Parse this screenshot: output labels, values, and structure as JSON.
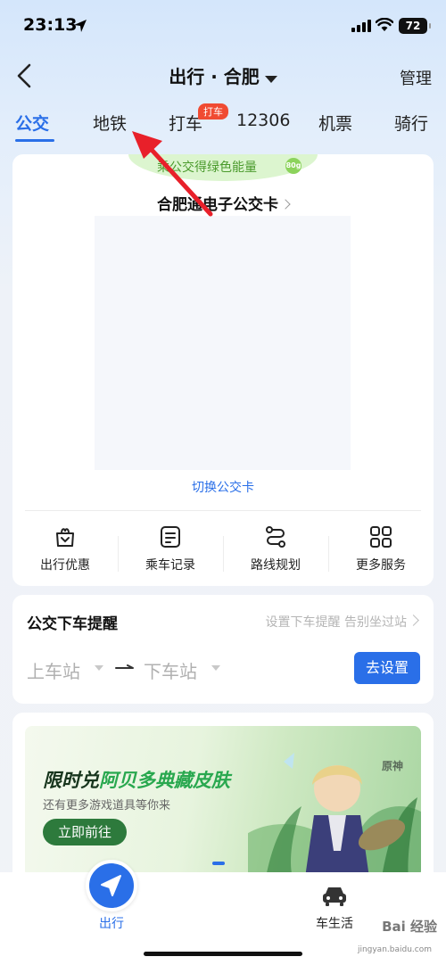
{
  "status_bar": {
    "time": "23:13",
    "battery": "72"
  },
  "nav": {
    "title": "出行 · 合肥",
    "manage": "管理"
  },
  "tabs": [
    {
      "label": "公交",
      "active": true
    },
    {
      "label": "地铁"
    },
    {
      "label": "打车",
      "badge": "打车"
    },
    {
      "label": "12306"
    },
    {
      "label": "机票"
    },
    {
      "label": "骑行"
    }
  ],
  "bus_card": {
    "energy_text": "乘公交得绿色能量",
    "energy_badge": "80g",
    "title": "合肥通电子公交卡",
    "switch_label": "切换公交卡"
  },
  "services": [
    {
      "label": "出行优惠",
      "icon": "gift-bag-icon"
    },
    {
      "label": "乘车记录",
      "icon": "record-icon"
    },
    {
      "label": "路线规划",
      "icon": "route-icon"
    },
    {
      "label": "更多服务",
      "icon": "grid-icon"
    }
  ],
  "reminder": {
    "title": "公交下车提醒",
    "hint": "设置下车提醒 告别坐过站",
    "from": "上车站",
    "to": "下车站",
    "button": "去设置"
  },
  "banner": {
    "headline_a": "限时兑",
    "headline_b": "阿贝多典藏皮肤",
    "subtitle": "还有更多游戏道具等你来",
    "button": "立即前往",
    "logo": "原神"
  },
  "tabbar": {
    "go_label": "出行",
    "car_label": "车生活"
  },
  "watermark": {
    "main": "Bai 经验",
    "sub": "jingyan.baidu.com"
  },
  "colors": {
    "accent": "#2a6fe8",
    "badge": "#f04b32",
    "energy": "#4a9a2c",
    "annotation": "#e8202a"
  }
}
